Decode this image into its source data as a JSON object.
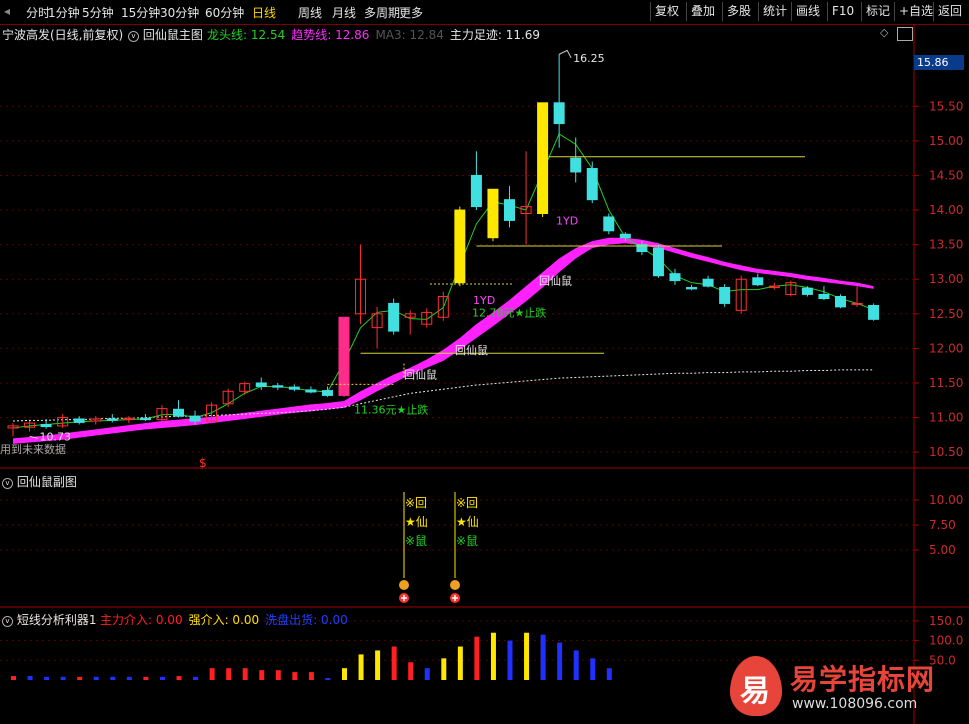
{
  "toolbar": {
    "periods": [
      "分时",
      "1分钟",
      "5分钟",
      "15分钟",
      "30分钟",
      "60分钟",
      "日线",
      "周线",
      "月线",
      "多周期",
      "更多"
    ],
    "active_period": "日线",
    "right_buttons": [
      "复权",
      "叠加",
      "多股",
      "统计",
      "画线",
      "F10",
      "标记",
      "+自选",
      "返回"
    ]
  },
  "main_panel": {
    "stock_title": "宁波高发(日线,前复权)",
    "indicator_name": "回仙鼠主图",
    "legend": [
      {
        "label": "龙头线: 12.54",
        "color": "#22d022"
      },
      {
        "label": "趋势线: 12.86",
        "color": "#ff2cff"
      },
      {
        "label": "MA3: 12.84",
        "color": "#555555"
      },
      {
        "label": "主力足迹: 11.69",
        "color": "#e6e6e6"
      }
    ],
    "future_note": "用到未来数据",
    "dollar_mark": "$",
    "current_price": "15.86",
    "high_label": "16.25",
    "low_label": "10.73",
    "annotations": [
      "1YD",
      "1YD",
      "回仙鼠",
      "回仙鼠",
      "回仙鼠",
      "12.78元★止跌",
      "11.36元★止跌"
    ],
    "y_axis": [
      "15.50",
      "15.00",
      "14.50",
      "14.00",
      "13.50",
      "13.00",
      "12.50",
      "12.00",
      "11.50",
      "11.00",
      "10.50"
    ]
  },
  "sub_panel": {
    "title": "回仙鼠副图",
    "signal_chars": [
      "※回",
      "★仙",
      "※鼠"
    ],
    "y_axis": [
      "10.00",
      "7.50",
      "5.00"
    ]
  },
  "bottom_panel": {
    "title": "短线分析利器1",
    "legend": [
      {
        "label": "主力介入: 0.00",
        "color": "#ff2020"
      },
      {
        "label": "强介入: 0.00",
        "color": "#ffe000"
      },
      {
        "label": "洗盘出货: 0.00",
        "color": "#2040ff"
      }
    ],
    "y_axis": [
      "150.0",
      "100.0",
      "50.0"
    ]
  },
  "watermark": {
    "brand": "易学指标网",
    "url": "www.108096.com",
    "badge": "易"
  },
  "chart_data": {
    "type": "candlestick",
    "candles": [
      {
        "o": 10.85,
        "h": 10.92,
        "l": 10.73,
        "c": 10.88
      },
      {
        "o": 10.86,
        "h": 10.95,
        "l": 10.8,
        "c": 10.92
      },
      {
        "o": 10.9,
        "h": 10.98,
        "l": 10.84,
        "c": 10.87
      },
      {
        "o": 10.88,
        "h": 11.05,
        "l": 10.85,
        "c": 11.0
      },
      {
        "o": 10.98,
        "h": 11.02,
        "l": 10.9,
        "c": 10.93
      },
      {
        "o": 10.95,
        "h": 11.02,
        "l": 10.9,
        "c": 10.98
      },
      {
        "o": 10.98,
        "h": 11.05,
        "l": 10.93,
        "c": 10.96
      },
      {
        "o": 10.97,
        "h": 11.02,
        "l": 10.92,
        "c": 10.99
      },
      {
        "o": 10.99,
        "h": 11.05,
        "l": 10.95,
        "c": 10.97
      },
      {
        "o": 10.97,
        "h": 11.18,
        "l": 10.95,
        "c": 11.13
      },
      {
        "o": 11.12,
        "h": 11.25,
        "l": 11.0,
        "c": 11.02
      },
      {
        "o": 11.02,
        "h": 11.1,
        "l": 10.9,
        "c": 10.95
      },
      {
        "o": 10.95,
        "h": 11.22,
        "l": 10.92,
        "c": 11.18
      },
      {
        "o": 11.2,
        "h": 11.42,
        "l": 11.15,
        "c": 11.38
      },
      {
        "o": 11.38,
        "h": 11.52,
        "l": 11.33,
        "c": 11.49
      },
      {
        "o": 11.5,
        "h": 11.58,
        "l": 11.4,
        "c": 11.45
      },
      {
        "o": 11.46,
        "h": 11.5,
        "l": 11.4,
        "c": 11.44
      },
      {
        "o": 11.44,
        "h": 11.48,
        "l": 11.38,
        "c": 11.41
      },
      {
        "o": 11.4,
        "h": 11.45,
        "l": 11.35,
        "c": 11.37
      },
      {
        "o": 11.39,
        "h": 11.45,
        "l": 11.3,
        "c": 11.32
      },
      {
        "o": 11.32,
        "h": 12.45,
        "l": 11.3,
        "c": 12.45
      },
      {
        "o": 12.5,
        "h": 13.5,
        "l": 12.35,
        "c": 13.0
      },
      {
        "o": 12.3,
        "h": 12.6,
        "l": 12.0,
        "c": 12.5
      },
      {
        "o": 12.65,
        "h": 12.72,
        "l": 12.2,
        "c": 12.25
      },
      {
        "o": 12.45,
        "h": 12.55,
        "l": 12.2,
        "c": 12.5
      },
      {
        "o": 12.35,
        "h": 12.58,
        "l": 12.3,
        "c": 12.52
      },
      {
        "o": 12.45,
        "h": 12.82,
        "l": 12.4,
        "c": 12.75
      },
      {
        "o": 12.95,
        "h": 14.05,
        "l": 12.9,
        "c": 14.0
      },
      {
        "o": 14.5,
        "h": 14.85,
        "l": 14.0,
        "c": 14.05
      },
      {
        "o": 13.6,
        "h": 14.3,
        "l": 13.55,
        "c": 14.3
      },
      {
        "o": 14.15,
        "h": 14.35,
        "l": 13.75,
        "c": 13.85
      },
      {
        "o": 13.95,
        "h": 14.85,
        "l": 13.5,
        "c": 14.05
      },
      {
        "o": 13.95,
        "h": 15.55,
        "l": 13.9,
        "c": 15.55
      },
      {
        "o": 15.55,
        "h": 16.25,
        "l": 14.9,
        "c": 15.25
      },
      {
        "o": 14.75,
        "h": 15.05,
        "l": 14.4,
        "c": 14.55
      },
      {
        "o": 14.6,
        "h": 14.7,
        "l": 14.1,
        "c": 14.15
      },
      {
        "o": 13.9,
        "h": 13.95,
        "l": 13.65,
        "c": 13.7
      },
      {
        "o": 13.65,
        "h": 13.68,
        "l": 13.55,
        "c": 13.6
      },
      {
        "o": 13.5,
        "h": 13.55,
        "l": 13.35,
        "c": 13.4
      },
      {
        "o": 13.45,
        "h": 13.5,
        "l": 13.02,
        "c": 13.05
      },
      {
        "o": 13.08,
        "h": 13.15,
        "l": 12.92,
        "c": 12.98
      },
      {
        "o": 12.88,
        "h": 12.92,
        "l": 12.84,
        "c": 12.86
      },
      {
        "o": 13.0,
        "h": 13.05,
        "l": 12.88,
        "c": 12.9
      },
      {
        "o": 12.88,
        "h": 12.93,
        "l": 12.6,
        "c": 12.65
      },
      {
        "o": 12.55,
        "h": 13.05,
        "l": 12.5,
        "c": 13.0
      },
      {
        "o": 13.02,
        "h": 13.08,
        "l": 12.9,
        "c": 12.92
      },
      {
        "o": 12.88,
        "h": 12.95,
        "l": 12.85,
        "c": 12.9
      },
      {
        "o": 12.78,
        "h": 12.98,
        "l": 12.75,
        "c": 12.95
      },
      {
        "o": 12.87,
        "h": 12.9,
        "l": 12.75,
        "c": 12.78
      },
      {
        "o": 12.78,
        "h": 12.9,
        "l": 12.7,
        "c": 12.72
      },
      {
        "o": 12.75,
        "h": 12.78,
        "l": 12.58,
        "c": 12.6
      },
      {
        "o": 12.65,
        "h": 12.9,
        "l": 12.6,
        "c": 12.65
      },
      {
        "o": 12.62,
        "h": 12.65,
        "l": 12.4,
        "c": 12.42
      }
    ],
    "trend_upper": [
      10.7,
      10.72,
      10.74,
      10.77,
      10.8,
      10.83,
      10.86,
      10.89,
      10.92,
      10.95,
      10.97,
      10.99,
      11.01,
      11.04,
      11.07,
      11.1,
      11.13,
      11.16,
      11.19,
      11.21,
      11.24,
      11.38,
      11.5,
      11.62,
      11.72,
      11.84,
      11.98,
      12.15,
      12.35,
      12.52,
      12.7,
      12.9,
      13.1,
      13.3,
      13.45,
      13.55,
      13.6,
      13.6,
      13.57,
      13.52,
      13.45,
      13.38,
      13.32,
      13.25,
      13.2,
      13.15,
      13.12,
      13.09,
      13.05,
      13.02,
      12.98,
      12.95,
      12.9
    ],
    "trend_lower": [
      10.62,
      10.64,
      10.66,
      10.68,
      10.71,
      10.74,
      10.77,
      10.8,
      10.83,
      10.85,
      10.87,
      10.89,
      10.92,
      10.95,
      10.98,
      11.01,
      11.04,
      11.07,
      11.09,
      11.12,
      11.14,
      11.25,
      11.38,
      11.5,
      11.62,
      11.72,
      11.82,
      11.98,
      12.15,
      12.32,
      12.5,
      12.68,
      12.88,
      13.1,
      13.3,
      13.45,
      13.5,
      13.52,
      13.49,
      13.45,
      13.38,
      13.31,
      13.25,
      13.19,
      13.13,
      13.09,
      13.06,
      13.03,
      12.99,
      12.96,
      12.93,
      12.9,
      12.86
    ],
    "dragon_line": [
      10.85,
      10.88,
      10.9,
      10.92,
      10.94,
      10.95,
      10.96,
      10.97,
      10.98,
      11.04,
      11.05,
      11.0,
      11.07,
      11.2,
      11.35,
      11.45,
      11.45,
      11.42,
      11.39,
      11.37,
      11.8,
      12.3,
      12.52,
      12.55,
      12.43,
      12.42,
      12.59,
      13.2,
      13.8,
      14.12,
      14.07,
      14.0,
      14.55,
      15.1,
      14.95,
      14.6,
      14.0,
      13.6,
      13.45,
      13.3,
      13.05,
      12.95,
      12.92,
      12.82,
      12.85,
      12.85,
      12.9,
      12.92,
      12.88,
      12.82,
      12.72,
      12.65,
      12.56
    ],
    "main_footprint": [
      10.95,
      10.96,
      10.96,
      10.97,
      10.97,
      10.98,
      10.99,
      10.99,
      11.0,
      11.01,
      11.02,
      11.02,
      11.03,
      11.04,
      11.05,
      11.06,
      11.07,
      11.08,
      11.1,
      11.12,
      11.15,
      11.2,
      11.25,
      11.3,
      11.35,
      11.38,
      11.41,
      11.44,
      11.47,
      11.49,
      11.51,
      11.53,
      11.55,
      11.57,
      11.58,
      11.59,
      11.6,
      11.61,
      11.62,
      11.63,
      11.64,
      11.64,
      11.65,
      11.65,
      11.66,
      11.66,
      11.67,
      11.67,
      11.68,
      11.68,
      11.69,
      11.69,
      11.69
    ],
    "bottom_bars": [
      {
        "v": 10,
        "c": "red"
      },
      {
        "v": 10,
        "c": "blue"
      },
      {
        "v": 8,
        "c": "blue"
      },
      {
        "v": 8,
        "c": "blue"
      },
      {
        "v": 8,
        "c": "red"
      },
      {
        "v": 8,
        "c": "blue"
      },
      {
        "v": 8,
        "c": "blue"
      },
      {
        "v": 8,
        "c": "blue"
      },
      {
        "v": 8,
        "c": "red"
      },
      {
        "v": 8,
        "c": "blue"
      },
      {
        "v": 10,
        "c": "red"
      },
      {
        "v": 8,
        "c": "blue"
      },
      {
        "v": 30,
        "c": "red"
      },
      {
        "v": 30,
        "c": "red"
      },
      {
        "v": 30,
        "c": "red"
      },
      {
        "v": 25,
        "c": "red"
      },
      {
        "v": 25,
        "c": "red"
      },
      {
        "v": 20,
        "c": "red"
      },
      {
        "v": 20,
        "c": "red"
      },
      {
        "v": 5,
        "c": "blue"
      },
      {
        "v": 30,
        "c": "yellow"
      },
      {
        "v": 65,
        "c": "yellow"
      },
      {
        "v": 75,
        "c": "yellow"
      },
      {
        "v": 85,
        "c": "red"
      },
      {
        "v": 45,
        "c": "red"
      },
      {
        "v": 30,
        "c": "blue"
      },
      {
        "v": 55,
        "c": "yellow"
      },
      {
        "v": 85,
        "c": "yellow"
      },
      {
        "v": 110,
        "c": "red"
      },
      {
        "v": 120,
        "c": "yellow"
      },
      {
        "v": 100,
        "c": "blue"
      },
      {
        "v": 120,
        "c": "yellow"
      },
      {
        "v": 115,
        "c": "blue"
      },
      {
        "v": 95,
        "c": "blue"
      },
      {
        "v": 75,
        "c": "blue"
      },
      {
        "v": 55,
        "c": "blue"
      },
      {
        "v": 30,
        "c": "blue"
      }
    ],
    "signal_days": [
      23,
      27
    ],
    "ylim_main": [
      10.3,
      16.4
    ]
  }
}
